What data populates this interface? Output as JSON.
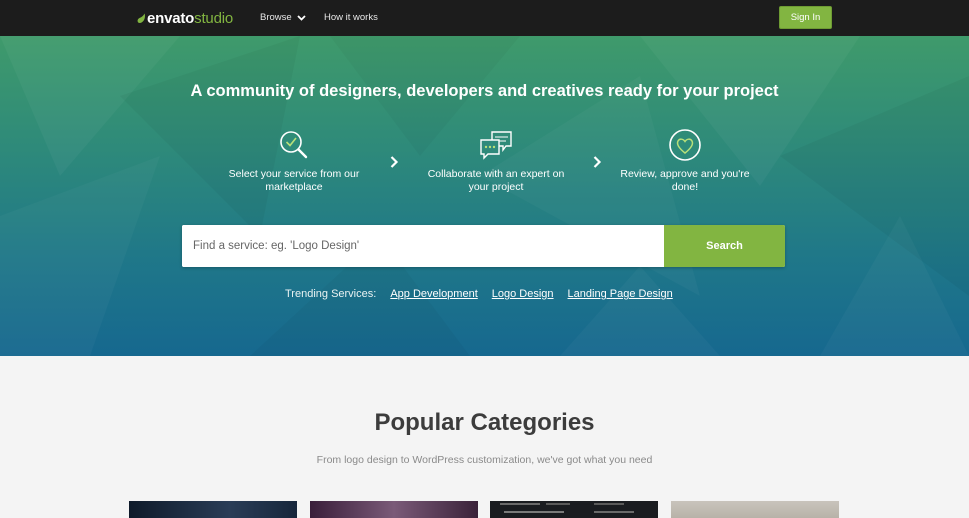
{
  "header": {
    "logo_brand": "envato",
    "logo_product": "studio",
    "nav": {
      "browse_label": "Browse",
      "how_label": "How it works"
    },
    "signin_label": "Sign In"
  },
  "hero": {
    "title": "A community of designers, developers and creatives ready for your project",
    "steps": [
      {
        "icon": "magnifier-check-icon",
        "text": "Select your service from our marketplace"
      },
      {
        "icon": "chat-bubbles-icon",
        "text": "Collaborate with an expert on your project"
      },
      {
        "icon": "heart-circle-icon",
        "text": "Review, approve and you're done!"
      }
    ],
    "search": {
      "placeholder": "Find a service: eg. 'Logo Design'",
      "button_label": "Search"
    },
    "trending": {
      "label": "Trending Services:",
      "links": [
        "App Development",
        "Logo Design",
        "Landing Page Design"
      ]
    }
  },
  "categories": {
    "title": "Popular Categories",
    "subtitle": "From logo design to WordPress customization, we've got what you need"
  },
  "colors": {
    "accent": "#82b541",
    "topbar": "#1c1c1c",
    "hero_top": "#3f9a6b",
    "hero_bottom": "#16688f"
  }
}
